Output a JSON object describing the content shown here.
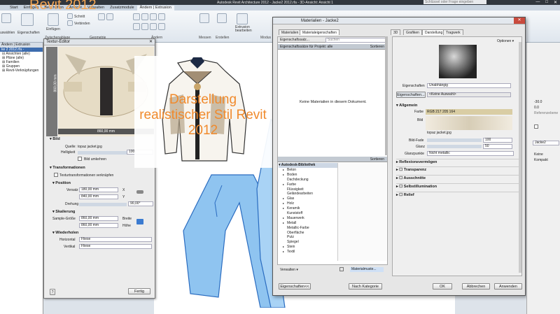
{
  "titlebar": {
    "title": "Autodesk Revit Architecture 2012 - Jacke2 2012.rfa - 3D-Ansicht: Ansicht 1",
    "search_placeholder": "Schlüssel oder Frage eingeben"
  },
  "tabs": [
    "Start",
    "Einfügen",
    "Beschriften",
    "Ansicht",
    "Verwalten",
    "Zusatzmodule",
    "Ändern | Extrusion"
  ],
  "overlay_title": "Revit 2012",
  "overlay_text": [
    "Darstellung",
    "realistischer Stil Revit",
    "2012"
  ],
  "ribbon": {
    "labels": [
      "uswählen",
      "Eigenschaften",
      "Einfügen",
      "Schnitt",
      "Verbinden",
      "Messen",
      "Erstellen",
      "Extrusion bearbeiten"
    ],
    "groups": [
      "Zwischenablage",
      "Geometrie",
      "Ändern",
      "Messen",
      "Erstellen",
      "Modus"
    ]
  },
  "browser": {
    "title": "Ändern | Extrusion",
    "subtitle": "ke 2 2012.rfa - Projektbrow",
    "items": [
      "Ansichten (alle)",
      "Pläne (alle)",
      "Familien",
      "Gruppen",
      "Revit-Verknüpfungen"
    ]
  },
  "texture_editor": {
    "title": "Textur-Editor",
    "dim_h": "860,00 mm",
    "dim_w": "860,00 mm",
    "section_bild": "Bild",
    "quelle_label": "Quelle:",
    "quelle_value": "topaz jacket.jpg",
    "helligkeit_label": "Helligkeit",
    "helligkeit_value": "100",
    "bild_umkehren": "Bild umkehren",
    "transformationen": "Transformationen",
    "texturtrans": "Texturtransformationen verknüpfen",
    "position": "Position",
    "versatz_label": "Versatz",
    "versatz_x": "180,00 mm",
    "versatz_y": "840,00 mm",
    "x": "X",
    "y": "Y",
    "drehung_label": "Drehung",
    "drehung_value": "90,00°",
    "skalierung": "Skalierung",
    "sample_label": "Sample-Größe",
    "breite_value": "860,00 mm",
    "hoehe_value": "860,00 mm",
    "breite": "Breite",
    "hoehe": "Höhe",
    "wiederholen": "Wiederholen",
    "horizontal_label": "Horizontal",
    "horizontal_value": "Fliese",
    "vertikal_label": "Vertikal",
    "vertikal_value": "Fliese",
    "help": "?",
    "fertig": "Fertig"
  },
  "materials": {
    "title": "Materialien - Jacke2",
    "tabs_left": [
      "Materialien",
      "Materialeigenschaften"
    ],
    "tabs_right": [
      "3D",
      "Grafiken",
      "Darstellung",
      "Tragwerk"
    ],
    "eig_label": "Eigenschaftssatz...",
    "search_placeholder": "Suchen",
    "eig_proj": "Eigenschaftssätze für Projekt: alle",
    "sortieren": "Sortieren",
    "no_mat": "Keine Materialien in diesem Dokument.",
    "library_title": "Autodesk-Bibliothek",
    "library": [
      {
        "label": "Beton",
        "arrow": true
      },
      {
        "label": "Boden",
        "arrow": true
      },
      {
        "label": "Dachdeckung",
        "arrow": false
      },
      {
        "label": "Farbe",
        "arrow": true
      },
      {
        "label": "Flüssigkeit",
        "arrow": false
      },
      {
        "label": "Geländearbeiten",
        "arrow": false
      },
      {
        "label": "Glas",
        "arrow": true
      },
      {
        "label": "Holz",
        "arrow": true
      },
      {
        "label": "Keramik",
        "arrow": true
      },
      {
        "label": "Kunststoff",
        "arrow": false
      },
      {
        "label": "Mauerwerk",
        "arrow": true
      },
      {
        "label": "Metall",
        "arrow": true
      },
      {
        "label": "Metallic-Farbe",
        "arrow": false
      },
      {
        "label": "Oberfläche",
        "arrow": false
      },
      {
        "label": "Putz",
        "arrow": false
      },
      {
        "label": "Spiegel",
        "arrow": false
      },
      {
        "label": "Stein",
        "arrow": true
      },
      {
        "label": "Textil",
        "arrow": true
      }
    ],
    "verwalten": "Verwalten",
    "materialmuste": "Materialmuste...",
    "optionen": "Optionen",
    "eigenschaften_label": "Eigenschaften",
    "eigenschaften_value": "Unabhängig",
    "eigenschaften_btn": "Eigenschaften...",
    "keine_auswahl": "<Keine Auswahl>",
    "allgemein": "Allgemein",
    "farbe_label": "Farbe",
    "farbe_value": "RGB 217 205 164",
    "bild_label": "Bild",
    "bild_name": "topaz jacket.jpg",
    "bildfade_label": "Bild-Fade",
    "bildfade_value": "100",
    "glanz_label": "Glanz",
    "glanz_value": "50",
    "glanzpunkte_label": "Glanzpunkte",
    "glanzpunkte_value": "Nicht metallic",
    "sections": [
      "Reflexionsvermögen",
      "Transparenz",
      "Ausschnitte",
      "Selbstillumination",
      "Relief"
    ],
    "btn_eig": "Eigenschaften<<",
    "btn_neu": "Nach Kategorie",
    "btn_ok": "OK",
    "btn_abbrechen": "Abbrechen",
    "btn_anwenden": "Anwenden",
    "farbe_color": "#d9cda4"
  },
  "props": {
    "v1": "-30.0",
    "v2": "0.0",
    "v3": "Referenzebene",
    "name": "Jacke2",
    "keine": "Keine",
    "kompakt": "Kompakt"
  }
}
